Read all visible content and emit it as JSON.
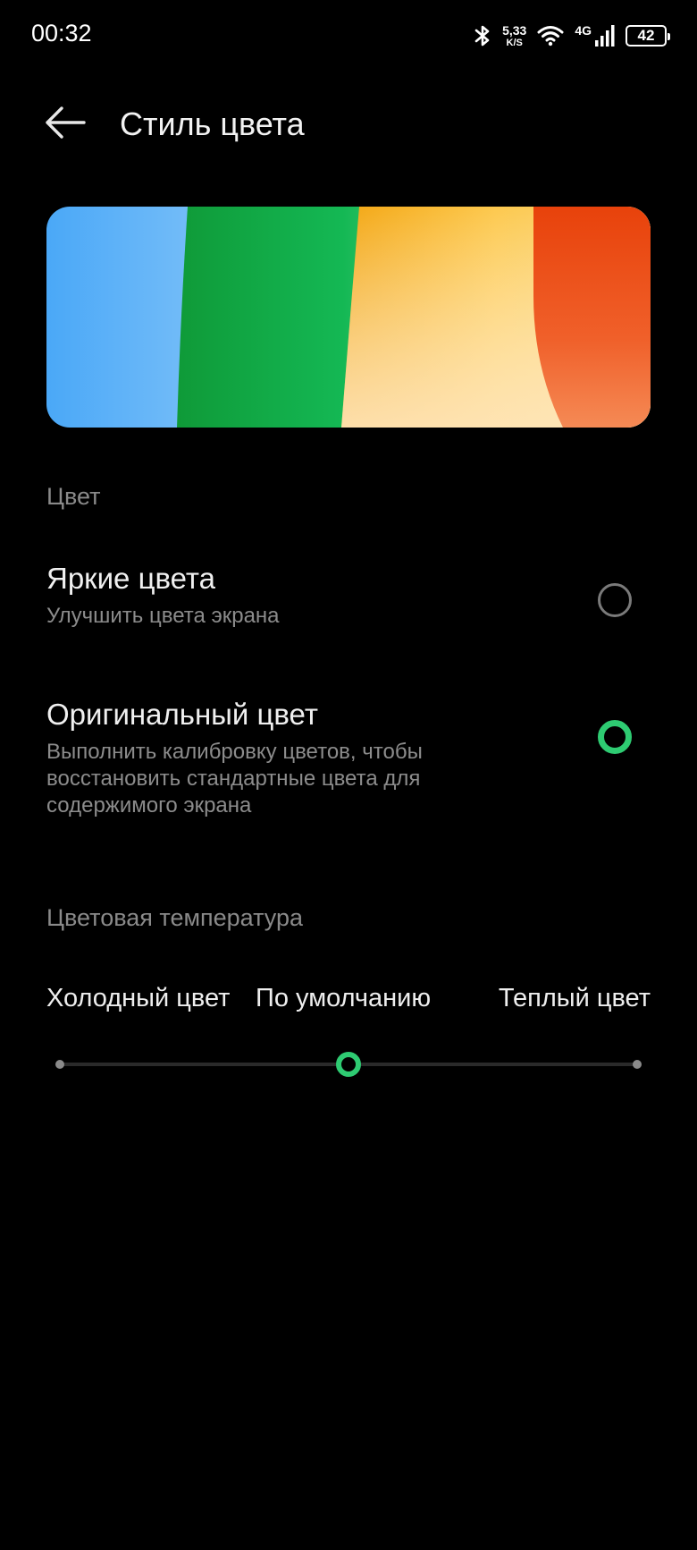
{
  "status_bar": {
    "time": "00:32",
    "net_speed_value": "5,33",
    "net_speed_unit": "K/S",
    "network_type": "4G",
    "battery": "42",
    "icons": [
      "bluetooth-icon",
      "wifi-icon",
      "signal-icon",
      "battery-icon"
    ]
  },
  "header": {
    "title": "Стиль цвета",
    "back_icon": "arrow-left-icon"
  },
  "sections": {
    "color_header": "Цвет",
    "temperature_header": "Цветовая температура"
  },
  "options": [
    {
      "title": "Яркие цвета",
      "description": "Улучшить цвета экрана",
      "selected": false
    },
    {
      "title": "Оригинальный цвет",
      "description": "Выполнить калибровку цветов, чтобы восстановить стандартные цвета для содержимого экрана",
      "selected": true
    }
  ],
  "temperature": {
    "cold_label": "Холодный цвет",
    "default_label": "По умолчанию",
    "warm_label": "Теплый цвет",
    "value": 0.5
  },
  "colors": {
    "accent": "#2ecb72",
    "background": "#000000"
  }
}
